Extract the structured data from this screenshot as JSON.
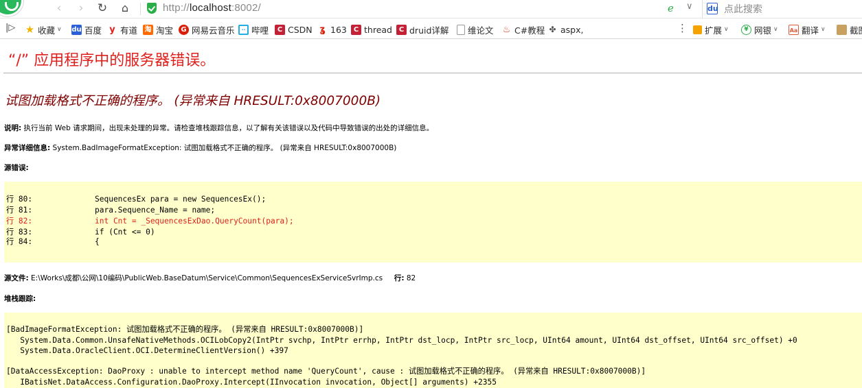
{
  "browser": {
    "url_proto": "http://",
    "url_host": "localhost",
    "url_rest": ":8002/",
    "search_placeholder": "点此搜索",
    "accent": "#2aae4a"
  },
  "bookmarks": [
    {
      "label": "收藏",
      "icon": "star-icon",
      "color": "#f0b400"
    },
    {
      "label": "百度",
      "icon": "baidu-icon",
      "color": "#2a5fd8"
    },
    {
      "label": "有道",
      "icon": "youdao-icon",
      "color": "#e02020"
    },
    {
      "label": "淘宝",
      "icon": "taobao-icon",
      "color": "#ff6a00"
    },
    {
      "label": "网易云音乐",
      "icon": "netease-music-icon",
      "color": "#d81e06"
    },
    {
      "label": "哔哩",
      "icon": "bilibili-icon",
      "color": "#23ade5"
    },
    {
      "label": "CSDN",
      "icon": "csdn-icon",
      "color": "#c32136"
    },
    {
      "label": "163",
      "icon": "163-icon",
      "color": "#d81e06"
    },
    {
      "label": "thread",
      "icon": "csdn-icon",
      "color": "#c32136"
    },
    {
      "label": "druid详解",
      "icon": "csdn-icon",
      "color": "#c32136"
    },
    {
      "label": "维论文",
      "icon": "page-icon",
      "color": "#9a9a9a"
    },
    {
      "label": "C#教程",
      "icon": "flame-icon",
      "color": "#e03c1e"
    },
    {
      "label": "aspx,",
      "icon": "script-icon",
      "color": "#555555"
    }
  ],
  "toolbar": {
    "extend": "扩展",
    "bank": "网银",
    "translate": "翻译",
    "screenshot": "截图"
  },
  "page": {
    "title": "“/” 应用程序中的服务器错误。",
    "error_message": "试图加载格式不正确的程序。 (异常来自 HRESULT:0x8007000B)",
    "desc_label": "说明:",
    "desc_text": "执行当前 Web 请求期间，出现未处理的异常。请检查堆栈跟踪信息，以了解有关该错误以及代码中导致错误的出处的详细信息。",
    "exc_label": "异常详细信息:",
    "exc_text": "System.BadImageFormatException: 试图加载格式不正确的程序。 (异常来自 HRESULT:0x8007000B)",
    "source_label": "源错误:",
    "source_lines": [
      {
        "label": "行 80:",
        "code": "SequencesEx para = new SequencesEx();",
        "error": false
      },
      {
        "label": "行 81:",
        "code": "para.Sequence_Name = name;",
        "error": false
      },
      {
        "label": "行 82:",
        "code": "int Cnt = _SequencesExDao.QueryCount(para);",
        "error": true
      },
      {
        "label": "行 83:",
        "code": "if (Cnt <= 0)",
        "error": false
      },
      {
        "label": "行 84:",
        "code": "{",
        "error": false
      }
    ],
    "file_label": "源文件:",
    "file_path": "E:\\Works\\成都\\公网\\10编码\\PublicWeb.BaseDatum\\Service\\Common\\SequencesExServiceSvrImp.cs",
    "line_label": "行:",
    "line_value": "82",
    "stack_label": "堆栈跟踪:",
    "stack_lines": [
      "[BadImageFormatException: 试图加载格式不正确的程序。 (异常来自 HRESULT:0x8007000B)]",
      "   System.Data.Common.UnsafeNativeMethods.OCILobCopy2(IntPtr svchp, IntPtr errhp, IntPtr dst_locp, IntPtr src_locp, UInt64 amount, UInt64 dst_offset, UInt64 src_offset) +0",
      "   System.Data.OracleClient.OCI.DetermineClientVersion() +397",
      "",
      "[DataAccessException: DaoProxy : unable to intercept method name 'QueryCount', cause : 试图加载格式不正确的程序。 (异常来自 HRESULT:0x8007000B)]",
      "   IBatisNet.DataAccess.Configuration.DaoProxy.Intercept(IInvocation invocation, Object[] arguments) +2355"
    ],
    "title_color": "#e0201c",
    "error_color": "#800000",
    "code_bg": "#ffffcc"
  }
}
